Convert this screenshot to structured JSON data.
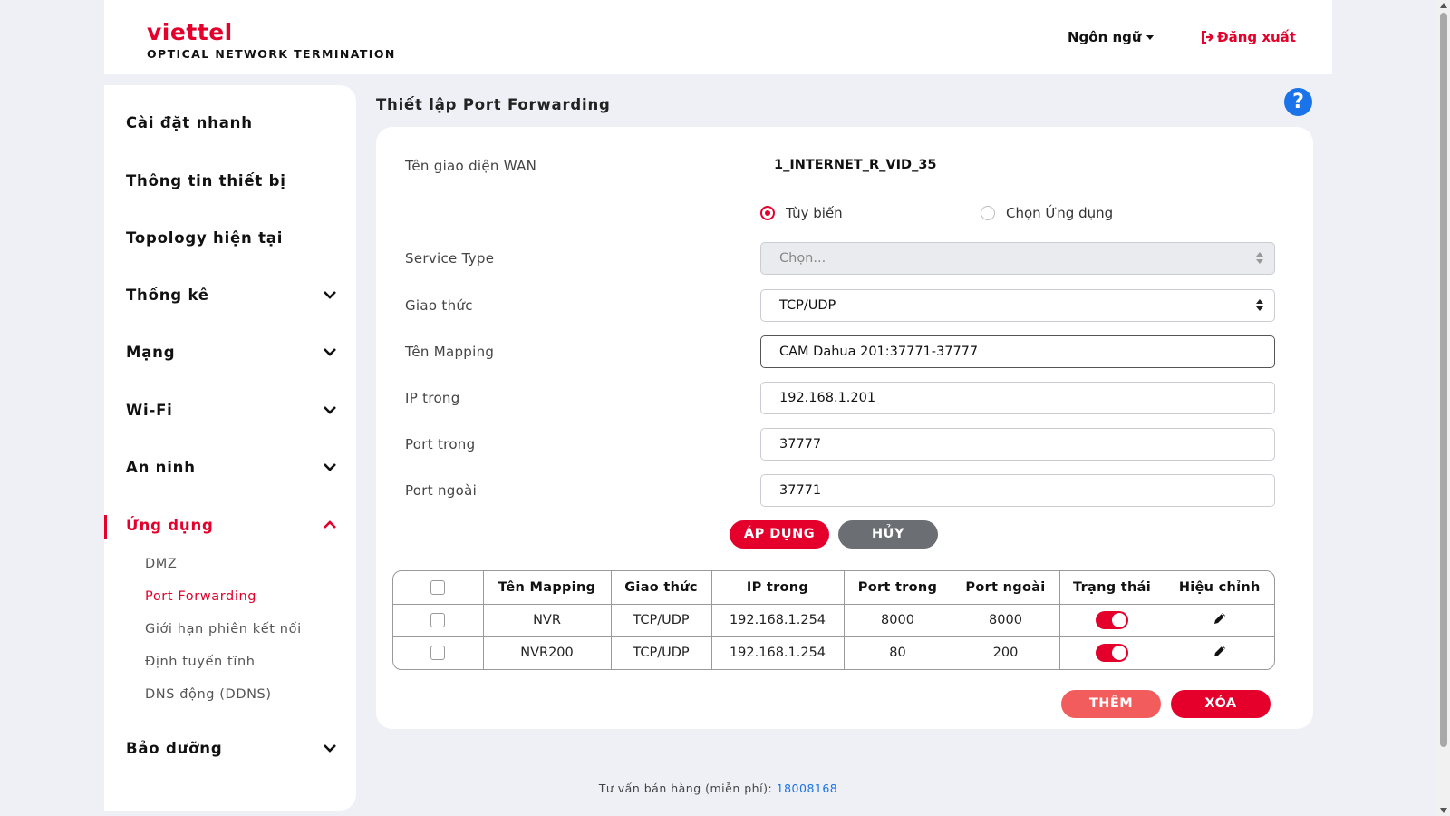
{
  "brand": {
    "name": "viettel",
    "subtitle": "OPTICAL NETWORK TERMINATION",
    "color": "#e4002b"
  },
  "header": {
    "language_label": "Ngôn ngữ",
    "logout_label": "Đăng xuất"
  },
  "sidebar": {
    "items": [
      {
        "label": "Cài đặt nhanh"
      },
      {
        "label": "Thông tin thiết bị"
      },
      {
        "label": "Topology hiện tại"
      },
      {
        "label": "Thống kê"
      },
      {
        "label": "Mạng"
      },
      {
        "label": "Wi-Fi"
      },
      {
        "label": "An ninh"
      },
      {
        "label": "Ứng dụng"
      },
      {
        "label": "Bảo dưỡng"
      }
    ],
    "sub_items": [
      {
        "label": "DMZ"
      },
      {
        "label": "Port Forwarding"
      },
      {
        "label": "Giới hạn phiên kết nối"
      },
      {
        "label": "Định tuyến tĩnh"
      },
      {
        "label": "DNS động (DDNS)"
      }
    ]
  },
  "page": {
    "title": "Thiết lập Port Forwarding",
    "help_label": "?"
  },
  "form": {
    "wan_label": "Tên giao diện WAN",
    "wan_value": "1_INTERNET_R_VID_35",
    "radio_custom": "Tùy biến",
    "radio_app": "Chọn Ứng dụng",
    "service_type_label": "Service Type",
    "service_type_value": "Chọn...",
    "protocol_label": "Giao thức",
    "protocol_value": "TCP/UDP",
    "mapping_label": "Tên Mapping",
    "mapping_value": "CAM Dahua 201:37771-37777",
    "ip_label": "IP trong",
    "ip_value": "192.168.1.201",
    "port_in_label": "Port trong",
    "port_in_value": "37777",
    "port_out_label": "Port ngoài",
    "port_out_value": "37771",
    "apply_label": "ÁP DỤNG",
    "cancel_label": "HỦY"
  },
  "table": {
    "headers": [
      "Tên Mapping",
      "Giao thức",
      "IP trong",
      "Port trong",
      "Port ngoài",
      "Trạng thái",
      "Hiệu chỉnh"
    ],
    "rows": [
      {
        "name": "NVR",
        "protocol": "TCP/UDP",
        "ip": "192.168.1.254",
        "port_in": "8000",
        "port_out": "8000",
        "enabled": true
      },
      {
        "name": "NVR200",
        "protocol": "TCP/UDP",
        "ip": "192.168.1.254",
        "port_in": "80",
        "port_out": "200",
        "enabled": true
      }
    ],
    "add_label": "THÊM",
    "delete_label": "XÓA"
  },
  "footer": {
    "text": "Tư vấn bán hàng (miễn phí): ",
    "phone": "18008168"
  }
}
